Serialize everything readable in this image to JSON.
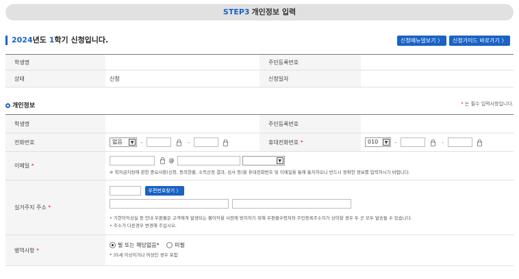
{
  "step": {
    "number": "STEP3",
    "title": "개인정보 입력"
  },
  "heading": {
    "year": "2024",
    "year_suffix": "년도",
    "term": "1",
    "term_suffix": "학기 신청입니다."
  },
  "top_buttons": {
    "manual": "신청매뉴얼보기 〉",
    "guide": "신청가이드 바로가기 〉"
  },
  "summary": {
    "student_name_label": "학생명",
    "student_name_value": "",
    "rrn_label": "주민등록번호",
    "rrn_value": "",
    "status_label": "상태",
    "status_value": "신청",
    "apply_date_label": "신청일자",
    "apply_date_value": ""
  },
  "section": {
    "title": "개인정보",
    "required_note_star": "*",
    "required_note": "는 필수 입력사항입니다."
  },
  "form": {
    "student_name_label": "학생명",
    "rrn_label": "주민등록번호",
    "phone_label": "전화번호",
    "phone_area_option": "없음",
    "mobile_label": "휴대전화번호",
    "mobile_prefix_option": "010",
    "email_label": "이메일",
    "email_at": "@",
    "email_notice": "※ 학자금지원에 관한 중요사항(신청, 등의현황, 소득산정 결과, 심사 등)을 휴대전화번호 및 이메일을 통해 통지하오니 반드시 정확한 정보를 입력하시기 바랍니다.",
    "address_label": "실거주지 주소",
    "zip_button": "우편번호찾기 〉",
    "address_note1": "• 기한이익상실 등 안내 우편물은 고객에게 발생되는 불이익을 사전에 방지하기 위해 우편물수령처와 주민등록주소지가 상이할 경우 두 곳 모두 발송될 수 있습니다.",
    "address_note2": "• 주소가 다른경우 변경해 주십시오.",
    "military_label": "병역사항",
    "military_option1": "필 또는 해당없음*",
    "military_option2": "미필",
    "military_note": "* 35세 이상이거나 여성인 경우 포함",
    "required_star": "*"
  }
}
